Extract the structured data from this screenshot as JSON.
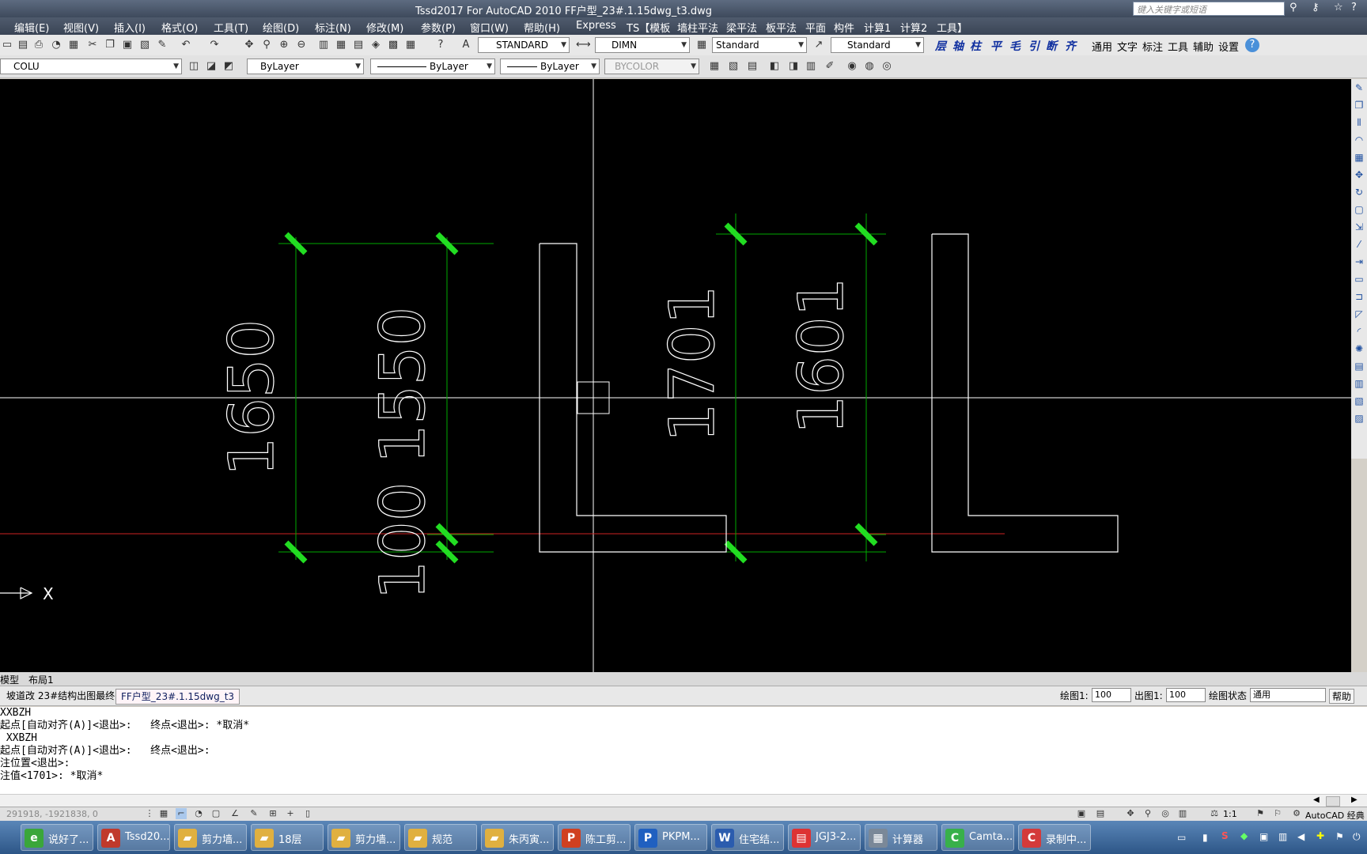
{
  "titlebar": {
    "title": "Tssd2017 For AutoCAD 2010    FF户型_23#.1.15dwg_t3.dwg",
    "search_placeholder": "键入关键字或短语"
  },
  "menu": [
    "编辑(E)",
    "视图(V)",
    "插入(I)",
    "格式(O)",
    "工具(T)",
    "绘图(D)",
    "标注(N)",
    "修改(M)",
    "参数(P)",
    "窗口(W)",
    "帮助(H)",
    "Express",
    "TS【模板",
    "墙柱平法",
    "梁平法",
    "板平法",
    "平面",
    "构件",
    "计算1",
    "计算2",
    "工具】"
  ],
  "toolbar1": {
    "text_style": "STANDARD",
    "dim_style": "DIMN",
    "table_style": "Standard",
    "mleader_style": "Standard",
    "ts_icons": [
      "层",
      "轴",
      "柱",
      "平",
      "毛",
      "引",
      "断",
      "齐"
    ],
    "ts_tabs": [
      "通用",
      "文字",
      "标注",
      "工具",
      "辅助",
      "设置"
    ]
  },
  "toolbar2": {
    "layer": "COLU",
    "color": "ByLayer",
    "linetype": "ByLayer",
    "lineweight": "ByLayer",
    "plotstyle": "BYCOLOR"
  },
  "drawing": {
    "dims": [
      "1650",
      "1550",
      "100",
      "1701",
      "1601"
    ],
    "ucs_x_label": "X",
    "colors": {
      "background": "#000000",
      "dimension": "#00aa00",
      "tick": "#22dd22",
      "outline": "#ffffff",
      "axis": "#cc2222"
    }
  },
  "layout_tabs": [
    "模型",
    "布局1"
  ],
  "doc_tabs": [
    "坡道改 23#结构出图最终",
    "FF户型_23#.1.15dwg_t3"
  ],
  "scales": {
    "draw_label": "绘图1:",
    "draw_value": "100",
    "plot_label": "出图1:",
    "plot_value": "100",
    "state_label": "绘图状态",
    "state_value": "通用",
    "help": "帮助"
  },
  "command_lines": [
    "XXBZH",
    "起点[自动对齐(A)]<退出>:   终点<退出>: *取消*",
    " XXBZH",
    "起点[自动对齐(A)]<退出>:   终点<退出>:",
    "注位置<退出>:",
    "注值<1701>: *取消*"
  ],
  "status": {
    "coords": "291918, -1921838, 0",
    "annotation_scale": "1:1",
    "workspace": "AutoCAD 经典"
  },
  "taskbar": [
    {
      "label": "说好了...",
      "icon": "e",
      "color": "#3aa63a"
    },
    {
      "label": "Tssd20...",
      "icon": "A",
      "color": "#c0392b"
    },
    {
      "label": "剪力墙...",
      "icon": "▰",
      "color": "#e0b040"
    },
    {
      "label": "18层",
      "icon": "▰",
      "color": "#e0b040"
    },
    {
      "label": "剪力墙...",
      "icon": "▰",
      "color": "#e0b040"
    },
    {
      "label": "规范",
      "icon": "▰",
      "color": "#e0b040"
    },
    {
      "label": "朱丙寅...",
      "icon": "▰",
      "color": "#e0b040"
    },
    {
      "label": "陈工剪...",
      "icon": "P",
      "color": "#d04020"
    },
    {
      "label": "PKPM...",
      "icon": "P",
      "color": "#2060c0"
    },
    {
      "label": "住宅结...",
      "icon": "W",
      "color": "#2b5cae"
    },
    {
      "label": "JGJ3-2...",
      "icon": "▤",
      "color": "#d33"
    },
    {
      "label": "计算器",
      "icon": "▦",
      "color": "#7a8898"
    },
    {
      "label": "Camta...",
      "icon": "C",
      "color": "#38b04a"
    },
    {
      "label": "录制中...",
      "icon": "C",
      "color": "#d43a3a"
    }
  ]
}
